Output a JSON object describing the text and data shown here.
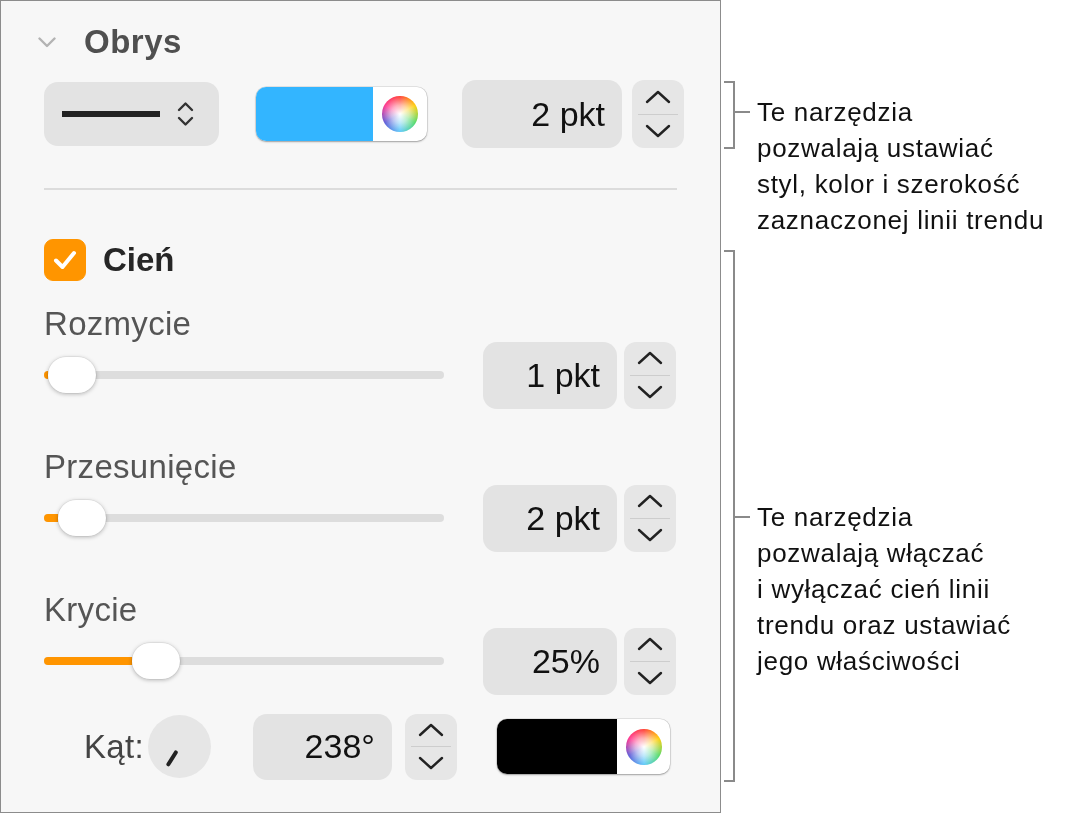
{
  "stroke": {
    "title": "Obrys",
    "expanded": true,
    "color": "#33b5ff",
    "width": "2 pkt"
  },
  "shadow": {
    "label": "Cień",
    "checked": true,
    "sliders": [
      {
        "label": "Rozmycie",
        "level": 0.01,
        "value": "1 pkt"
      },
      {
        "label": "Przesunięcie",
        "level": 0.035,
        "value": "2 pkt"
      },
      {
        "label": "Krycie",
        "level": 0.22,
        "value": "25%"
      }
    ],
    "angle": {
      "label": "Kąt:",
      "value": "238°"
    },
    "color": "#000000"
  },
  "callouts": [
    {
      "lines": [
        "Te narzędzia",
        "pozwalają ustawiać",
        "styl, kolor i szerokość",
        "zaznaczonej linii trendu"
      ]
    },
    {
      "lines": [
        "Te narzędzia",
        "pozwalają włączać",
        "i wyłączać cień linii",
        "trendu oraz ustawiać",
        "jego właściwości"
      ]
    }
  ]
}
